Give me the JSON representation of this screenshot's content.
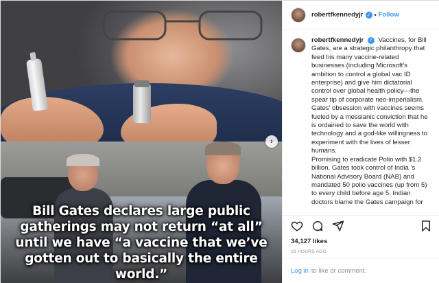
{
  "post": {
    "username": "robertfkennedyjr",
    "follow_label": "Follow",
    "dot": "•",
    "verified_glyph": "✓"
  },
  "media": {
    "overlay_text": "Bill Gates declares large public gatherings may not return “at all” until we have “a vaccine that we’ve gotten out to basically the entire world.”",
    "next_glyph": "›"
  },
  "caption": {
    "user": "robertfkennedyjr",
    "text_1": "Vaccines, for Bill Gates, are a strategic philanthropy that feed his many vaccine-related businesses (including Microsoft’s ambition to control a global vac ID enterprise) and give him dictatorial control over global health policy—the spear tip of corporate neo-imperialism.",
    "text_2": "Gates’ obsession with vaccines seems fueled by a messianic conviction that he is ordained to save the world with technology and a god-like willingness to experiment with the lives of lesser humans.",
    "text_3": "Promising to eradicate Polio with $1.2 billion, Gates took control of India ’s National Advisory Board (NAB) and mandated 50 polio vaccines (up from 5) to every child before age 5. Indian doctors blame the Gates campaign for"
  },
  "actions": {
    "likes": "34,127 likes",
    "timestamp": "18 HOURS AGO",
    "icons": [
      "heart-icon",
      "comment-icon",
      "share-icon",
      "bookmark-icon"
    ]
  },
  "login": {
    "link_label": "Log in",
    "rest_label": "to like or comment."
  },
  "colors": {
    "accent": "#3897f0",
    "text": "#262626",
    "muted": "#8e8e8e",
    "border": "#efefef"
  }
}
